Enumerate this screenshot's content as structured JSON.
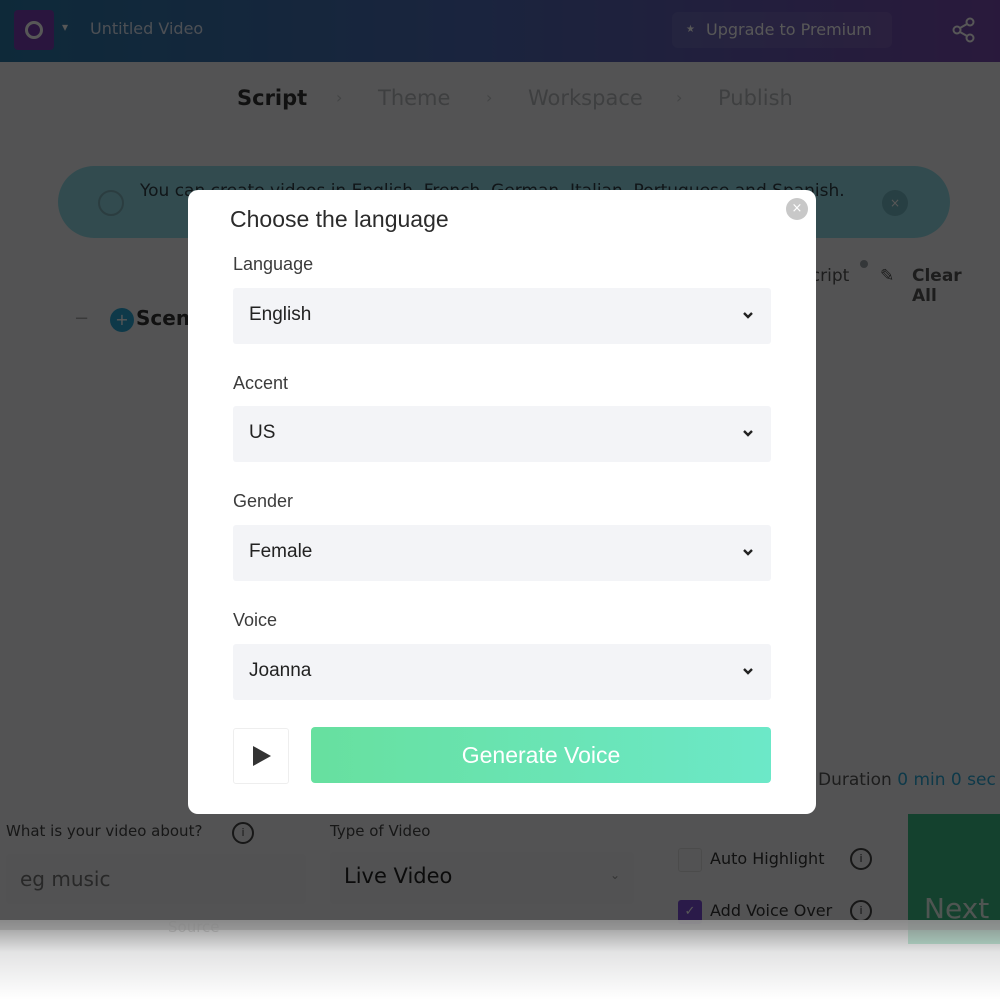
{
  "app": {
    "video_title": "Untitled Video",
    "upgrade_label": "Upgrade to Premium",
    "steps": [
      {
        "label": "Script",
        "active": true
      },
      {
        "label": "Theme",
        "active": false
      },
      {
        "label": "Workspace",
        "active": false
      },
      {
        "label": "Publish",
        "active": false
      }
    ],
    "step_separator": "›",
    "banner_text": "You can create videos in English, French, German, Italian, Portuguese and Spanish.",
    "banner_close": "×",
    "tools": {
      "script_label": "Script",
      "clear_all_label": "Clear All"
    },
    "scene": {
      "minus": "−",
      "plus": "+",
      "label": "Scene"
    },
    "duration": {
      "prefix": "Duration",
      "value": "0 min 0 sec"
    },
    "about": {
      "label": "What is your video about?",
      "info": "i",
      "placeholder": "eg music",
      "value": ""
    },
    "type_of_video": {
      "label": "Type of Video",
      "value": "Live Video",
      "caret": "⌄"
    },
    "source_label": "Source",
    "options": [
      {
        "label": "Auto Highlight",
        "checked": false,
        "info": "i"
      },
      {
        "label": "Add Voice Over",
        "checked": true,
        "info": "i",
        "check": "✓"
      }
    ],
    "next_label": "Next",
    "colors": {
      "accent_blue": "#2aa7d6",
      "next_green": "#3bbf87",
      "checkbox_purple": "#7c4dd6"
    }
  },
  "modal": {
    "title": "Choose the language",
    "close": "×",
    "fields": [
      {
        "label": "Language",
        "value": "English"
      },
      {
        "label": "Accent",
        "value": "US"
      },
      {
        "label": "Gender",
        "value": "Female"
      },
      {
        "label": "Voice",
        "value": "Joanna"
      }
    ],
    "generate_label": "Generate Voice",
    "play_icon": "play-icon",
    "colors": {
      "generate_start": "#67e09f",
      "generate_end": "#6ce8c8",
      "select_bg": "#f3f4f7"
    }
  }
}
